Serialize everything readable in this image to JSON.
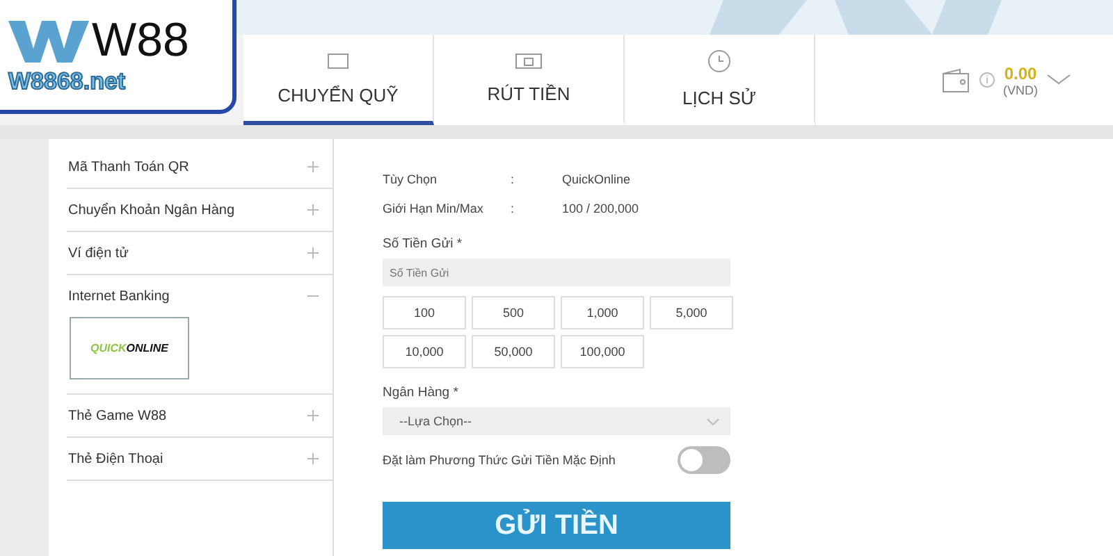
{
  "logo": {
    "brand": "W88",
    "domain": "W8868.net"
  },
  "tabs": [
    {
      "label": "CHUYỂN QUỸ",
      "selected": true
    },
    {
      "label": "RÚT TIỀN",
      "selected": false
    },
    {
      "label": "LỊCH SỬ",
      "selected": false
    }
  ],
  "wallet": {
    "balance": "0.00",
    "currency": "(VND)",
    "info": "i"
  },
  "sidebar": {
    "items": [
      {
        "label": "Mã Thanh Toán QR",
        "expanded": false
      },
      {
        "label": "Chuyển Khoản Ngân Hàng",
        "expanded": false
      },
      {
        "label": "Ví điện tử",
        "expanded": false
      },
      {
        "label": "Internet Banking",
        "expanded": true,
        "options": [
          {
            "lead": "QUICK",
            "tail": "ONLINE",
            "selected": true
          }
        ]
      },
      {
        "label": "Thẻ Game W88",
        "expanded": false
      },
      {
        "label": "Thẻ Điện Thoại",
        "expanded": false
      }
    ]
  },
  "form": {
    "info": [
      {
        "label": "Tùy Chọn",
        "separator": ":",
        "value": "QuickOnline"
      },
      {
        "label": "Giới Hạn Min/Max",
        "separator": ":",
        "value": "100 / 200,000"
      }
    ],
    "amount": {
      "label": "Số Tiền Gửi *",
      "placeholder": "Số Tiền Gửi"
    },
    "presets": [
      "100",
      "500",
      "1,000",
      "5,000",
      "10,000",
      "50,000",
      "100,000"
    ],
    "bank": {
      "label": "Ngân Hàng *",
      "value": "--Lựa Chọn--"
    },
    "default_toggle": {
      "label": "Đặt làm Phương Thức Gửi Tiền Mặc Định",
      "on": false
    },
    "submit": "GỬI TIỀN"
  }
}
